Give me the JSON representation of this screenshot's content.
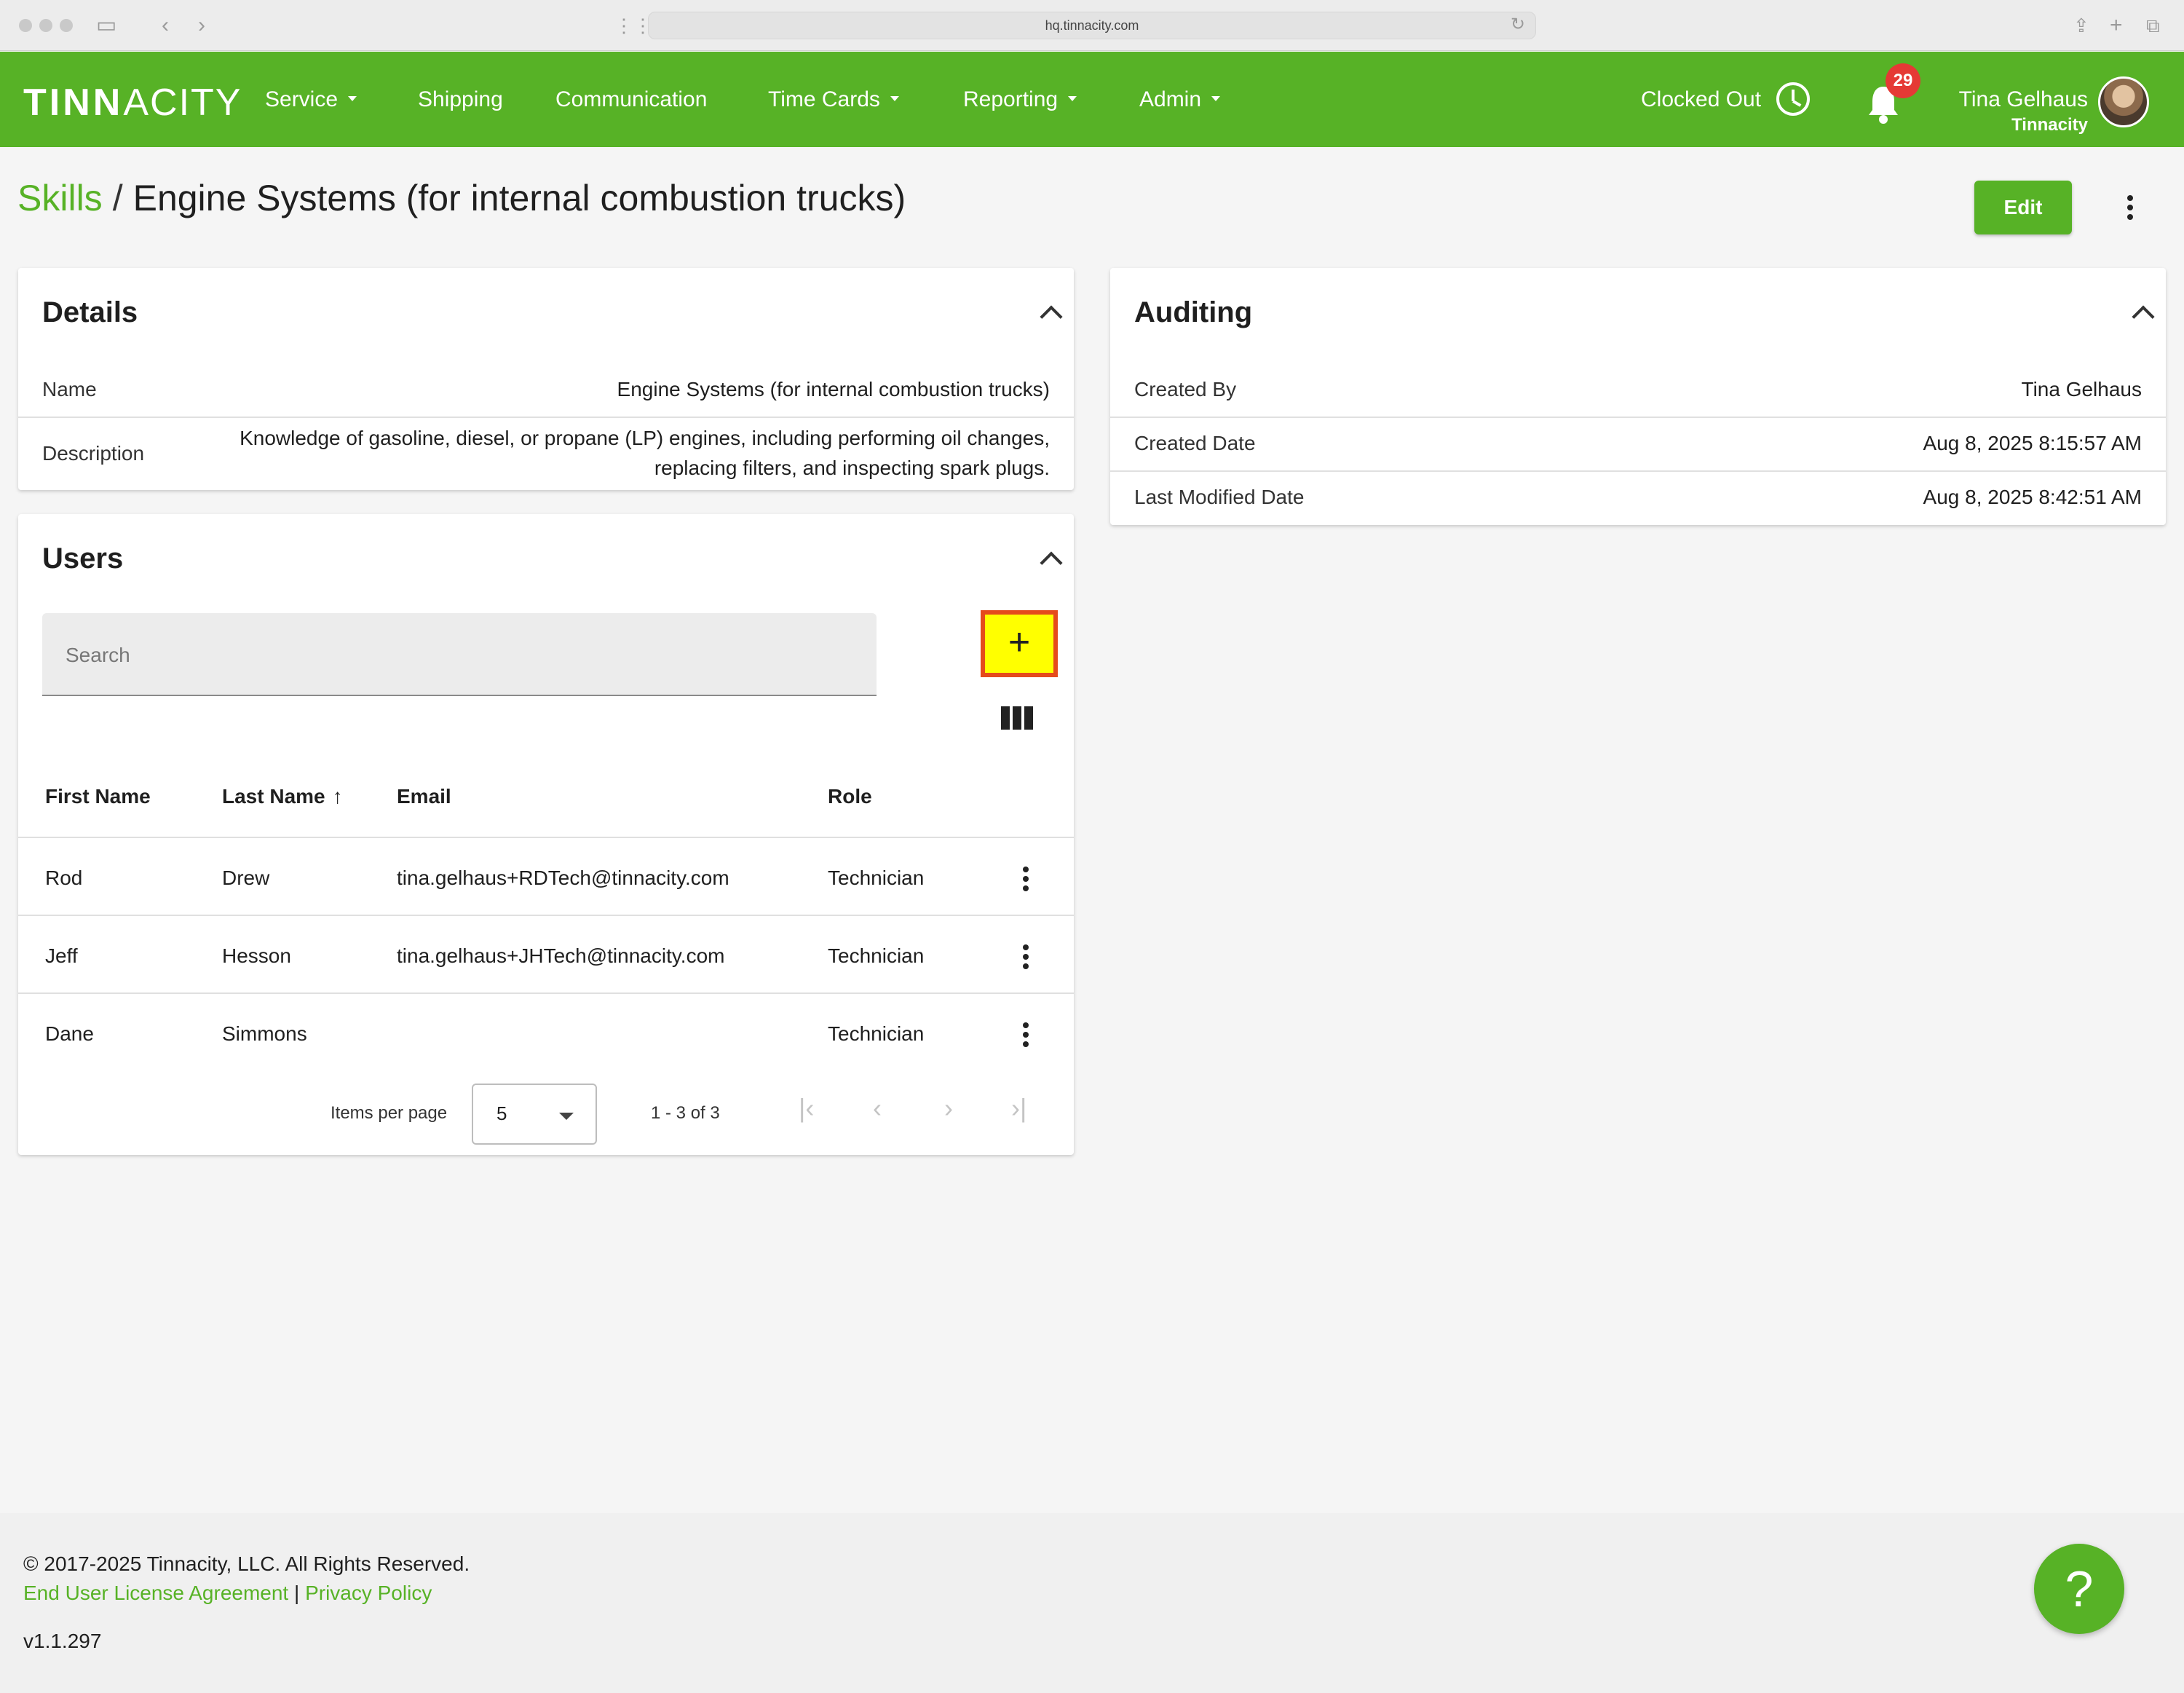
{
  "browser": {
    "url": "hq.tinnacity.com"
  },
  "nav": {
    "logo_bold": "TINN",
    "logo_thin": "ACITY",
    "items": [
      {
        "label": "Service",
        "dropdown": true
      },
      {
        "label": "Shipping",
        "dropdown": false
      },
      {
        "label": "Communication",
        "dropdown": false
      },
      {
        "label": "Time Cards",
        "dropdown": true
      },
      {
        "label": "Reporting",
        "dropdown": true
      },
      {
        "label": "Admin",
        "dropdown": true
      }
    ],
    "clock_status": "Clocked Out",
    "notification_count": "29",
    "user_name": "Tina Gelhaus",
    "user_org": "Tinnacity"
  },
  "header": {
    "breadcrumb_root": "Skills",
    "separator": "/",
    "title": "Engine Systems (for internal combustion trucks)",
    "edit_label": "Edit"
  },
  "details": {
    "title": "Details",
    "name_label": "Name",
    "name_value": "Engine Systems (for internal combustion trucks)",
    "description_label": "Description",
    "description_line1": "Knowledge of gasoline, diesel, or propane (LP) engines, including performing oil changes,",
    "description_line2": "replacing filters, and inspecting spark plugs."
  },
  "auditing": {
    "title": "Auditing",
    "rows": [
      {
        "label": "Created By",
        "value": "Tina Gelhaus"
      },
      {
        "label": "Created Date",
        "value": "Aug 8, 2025 8:15:57 AM"
      },
      {
        "label": "Last Modified Date",
        "value": "Aug 8, 2025 8:42:51 AM"
      }
    ]
  },
  "users": {
    "title": "Users",
    "search_placeholder": "Search",
    "add_label": "+",
    "columns": [
      "First Name",
      "Last Name",
      "Email",
      "Role"
    ],
    "sort_arrow": "↑",
    "rows": [
      {
        "first": "Rod",
        "last": "Drew",
        "email": "tina.gelhaus+RDTech@tinnacity.com",
        "role": "Technician"
      },
      {
        "first": "Jeff",
        "last": "Hesson",
        "email": "tina.gelhaus+JHTech@tinnacity.com",
        "role": "Technician"
      },
      {
        "first": "Dane",
        "last": "Simmons",
        "email": "",
        "role": "Technician"
      }
    ],
    "pager": {
      "items_per_page_label": "Items per page",
      "items_per_page": "5",
      "range": "1 - 3 of 3"
    }
  },
  "footer": {
    "copyright": "© 2017-2025 Tinnacity, LLC. All Rights Reserved.",
    "eula": "End User License Agreement",
    "link_separator": " | ",
    "privacy": "Privacy Policy",
    "version": "v1.1.297",
    "help_label": "?"
  }
}
